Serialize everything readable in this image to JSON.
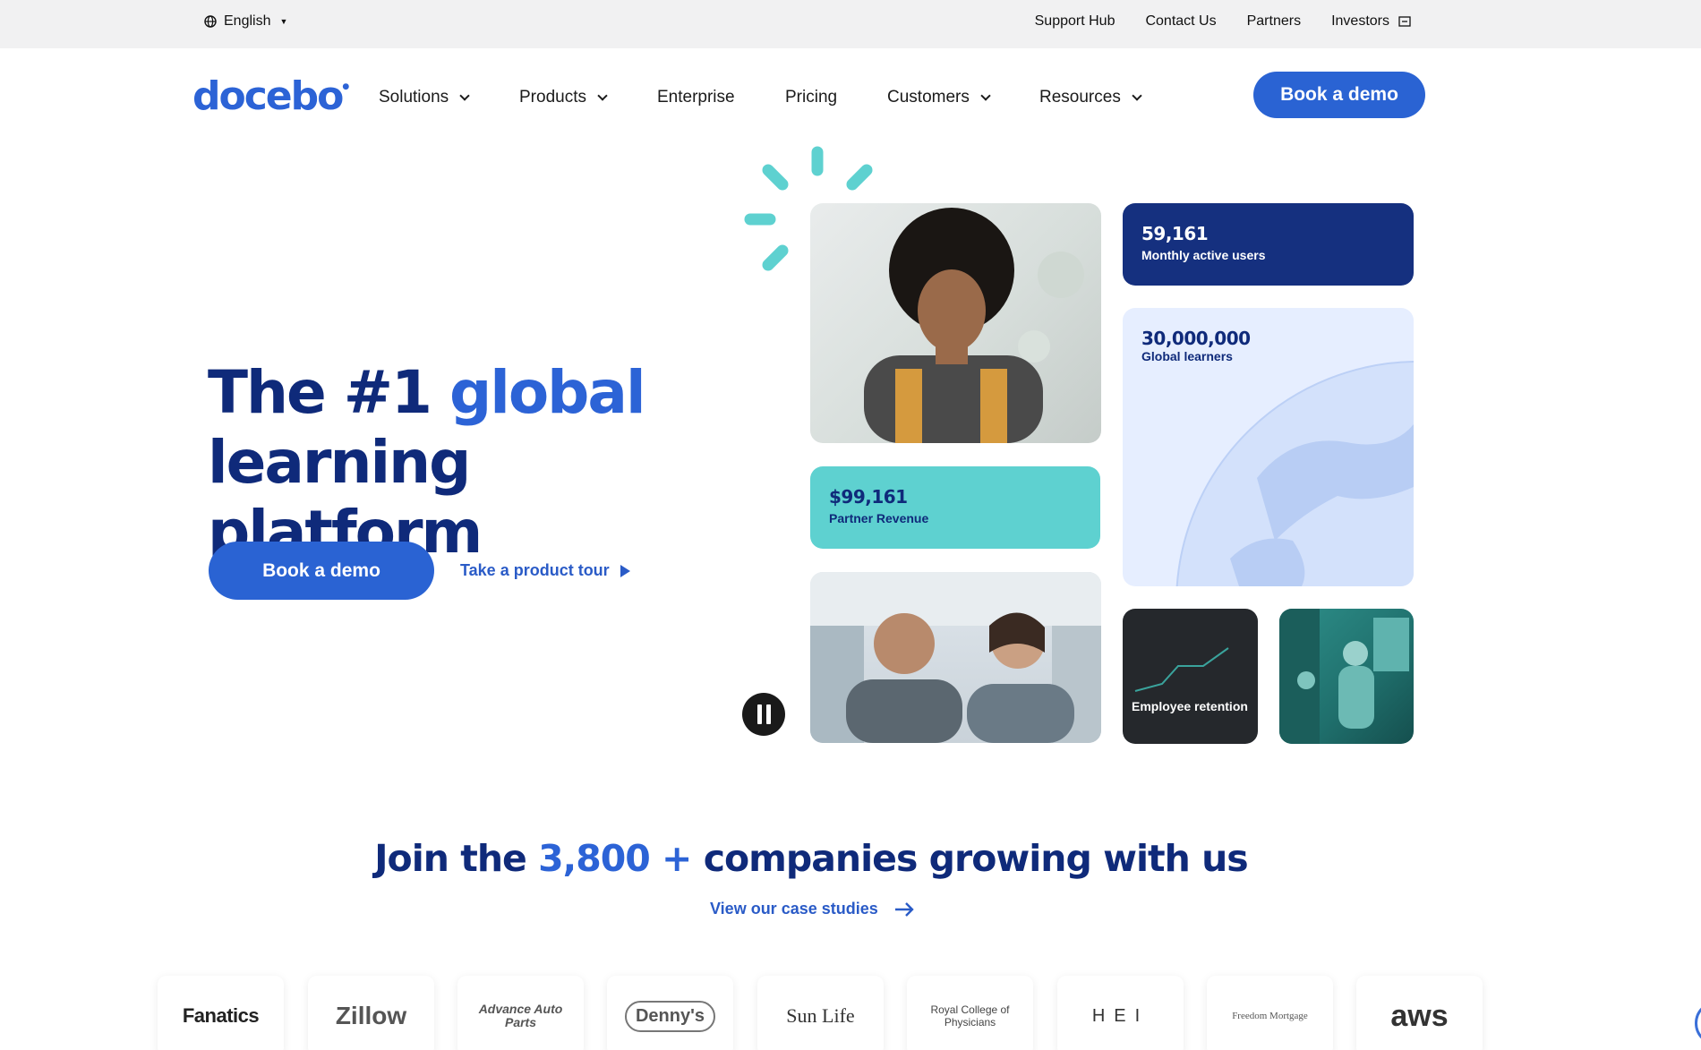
{
  "utility_bar": {
    "language": "English",
    "links": [
      "Support Hub",
      "Contact Us",
      "Partners",
      "Investors"
    ]
  },
  "nav": {
    "logo": "docebo",
    "items": [
      {
        "label": "Solutions",
        "dropdown": true
      },
      {
        "label": "Products",
        "dropdown": true
      },
      {
        "label": "Enterprise",
        "dropdown": false
      },
      {
        "label": "Pricing",
        "dropdown": false
      },
      {
        "label": "Customers",
        "dropdown": true
      },
      {
        "label": "Resources",
        "dropdown": true
      }
    ],
    "cta": "Book a demo"
  },
  "hero": {
    "title_part1": "The #1 ",
    "title_accent": "global",
    "title_part2": "learning platform",
    "cta": "Book a demo",
    "tour_link": "Take a product tour"
  },
  "stats": {
    "monthly_users_value": "59,161",
    "monthly_users_label": "Monthly active users",
    "global_learners_value": "30,000,000",
    "global_learners_label": "Global learners",
    "partner_revenue_value": "$99,161",
    "partner_revenue_label": "Partner Revenue",
    "retention_label": "Employee retention"
  },
  "companies": {
    "title_part1": "Join the ",
    "title_accent": "3,800 +",
    "title_part2": " companies growing with us",
    "case_link": "View our case studies",
    "logos": [
      "Fanatics",
      "Zillow",
      "Advance Auto Parts",
      "Denny's",
      "Sun Life",
      "Royal College of Physicians",
      "HEI",
      "Freedom Mortgage",
      "aws"
    ]
  },
  "colors": {
    "brand_blue": "#2a63d3",
    "navy": "#0f2a7a",
    "teal": "#5ed1d0"
  }
}
